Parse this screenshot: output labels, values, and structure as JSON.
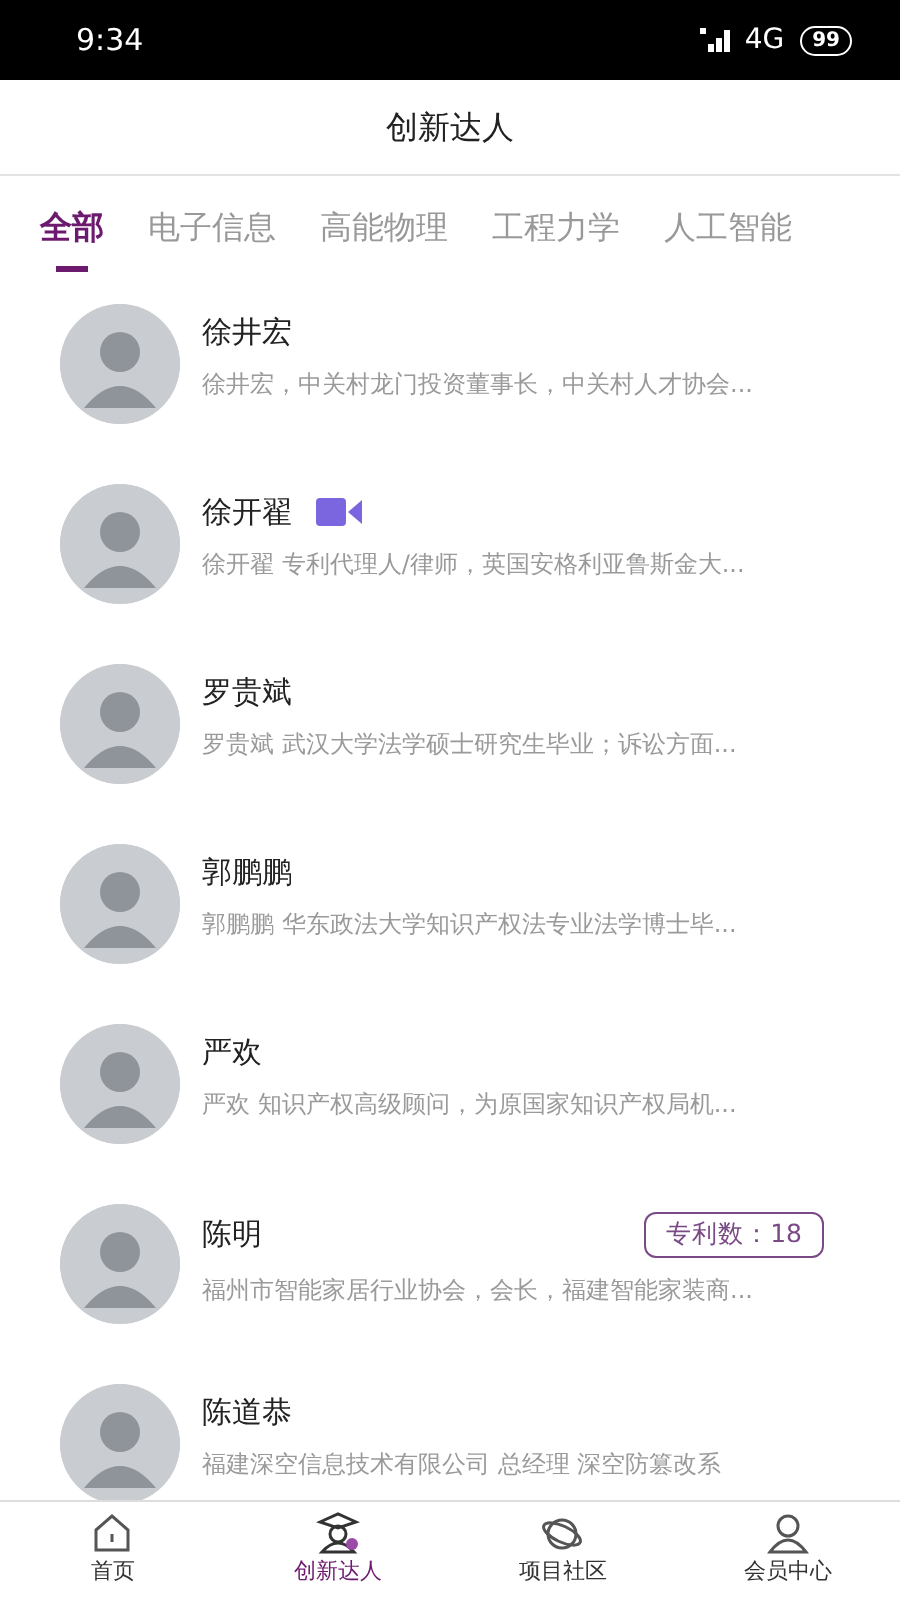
{
  "status_bar": {
    "time": "9:34",
    "network": "4G",
    "battery": "99"
  },
  "header": {
    "title": "创新达人"
  },
  "tabs": [
    {
      "label": "全部",
      "selected": true
    },
    {
      "label": "电子信息",
      "selected": false
    },
    {
      "label": "高能物理",
      "selected": false
    },
    {
      "label": "工程力学",
      "selected": false
    },
    {
      "label": "人工智能",
      "selected": false
    }
  ],
  "experts": [
    {
      "name": "徐井宏",
      "description": "徐井宏，中关村龙门投资董事长，中关村人才协会...",
      "video": false
    },
    {
      "name": "徐开翟",
      "description": "徐开翟 专利代理人/律师，英国安格利亚鲁斯金大...",
      "video": true
    },
    {
      "name": "罗贵斌",
      "description": "罗贵斌 武汉大学法学硕士研究生毕业；诉讼方面...",
      "video": false
    },
    {
      "name": "郭鹏鹏",
      "description": "郭鹏鹏 华东政法大学知识产权法专业法学博士毕...",
      "video": false
    },
    {
      "name": "严欢",
      "description": "严欢 知识产权高级顾问，为原国家知识产权局机...",
      "video": false
    },
    {
      "name": "陈明",
      "description": "福州市智能家居行业协会，会长，福建智能家装商...",
      "video": false,
      "badge": "专利数：18"
    },
    {
      "name": "陈道恭",
      "description": "福建深空信息技术有限公司 总经理 深空防篡改系",
      "video": false
    }
  ],
  "bottom_nav": [
    {
      "label": "首页",
      "kind": "home",
      "selected": false
    },
    {
      "label": "创新达人",
      "kind": "expert",
      "selected": true
    },
    {
      "label": "项目社区",
      "kind": "planet",
      "selected": false
    },
    {
      "label": "会员中心",
      "kind": "member",
      "selected": false
    }
  ]
}
